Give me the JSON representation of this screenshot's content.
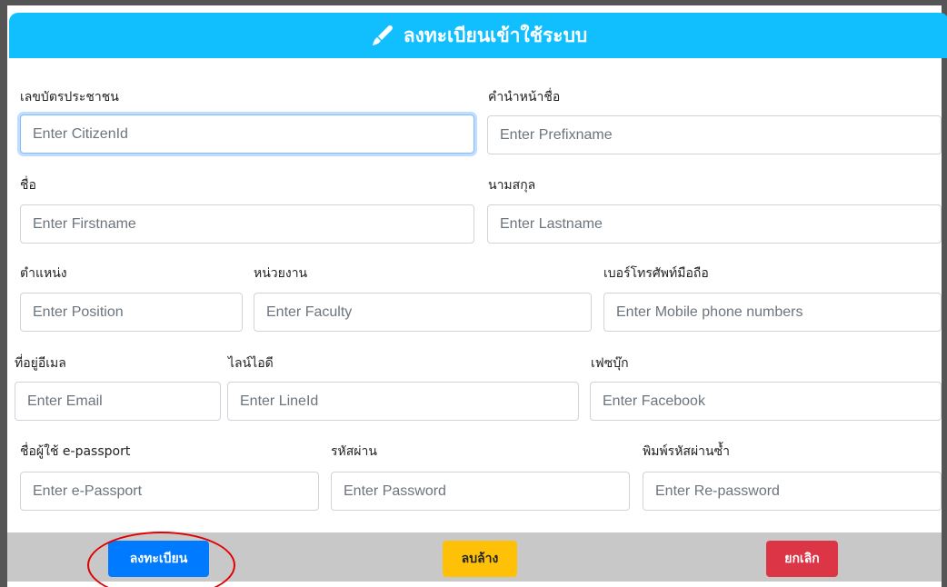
{
  "header": {
    "title": "ลงทะเบียนเข้าใช้ระบบ",
    "icon": "pen-icon",
    "color": "#11bfff"
  },
  "fields": {
    "citizen_id": {
      "label": "เลขบัตรประชาชน",
      "placeholder": "Enter CitizenId",
      "value": ""
    },
    "prefix": {
      "label": "คำนำหน้าชื่อ",
      "placeholder": "Enter Prefixname",
      "value": ""
    },
    "firstname": {
      "label": "ชื่อ",
      "placeholder": "Enter Firstname",
      "value": ""
    },
    "lastname": {
      "label": "นามสกุล",
      "placeholder": "Enter Lastname",
      "value": ""
    },
    "position": {
      "label": "ตำแหน่ง",
      "placeholder": "Enter Position",
      "value": ""
    },
    "faculty": {
      "label": "หน่วยงาน",
      "placeholder": "Enter Faculty",
      "value": ""
    },
    "mobile": {
      "label": "เบอร์โทรศัพท์มือถือ",
      "placeholder": "Enter Mobile phone numbers",
      "value": ""
    },
    "email": {
      "label": "ที่อยู่อีเมล",
      "placeholder": "Enter Email",
      "value": ""
    },
    "line_id": {
      "label": "ไลน์ไอดี",
      "placeholder": "Enter LineId",
      "value": ""
    },
    "facebook": {
      "label": "เฟซบุ๊ก",
      "placeholder": "Enter Facebook",
      "value": ""
    },
    "epassport": {
      "label": "ชื่อผู้ใช้ e-passport",
      "placeholder": "Enter e-Passport",
      "value": ""
    },
    "password": {
      "label": "รหัสผ่าน",
      "placeholder": "Enter Password",
      "value": ""
    },
    "repassword": {
      "label": "พิมพ์รหัสผ่านซ้ำ",
      "placeholder": "Enter Re-password",
      "value": ""
    }
  },
  "buttons": {
    "register": {
      "label": "ลงทะเบียน",
      "color": "#007bff"
    },
    "clear": {
      "label": "ลบล้าง",
      "color": "#ffc107"
    },
    "cancel": {
      "label": "ยกเลิก",
      "color": "#dc3545"
    }
  },
  "annotation_color": "#e00000"
}
